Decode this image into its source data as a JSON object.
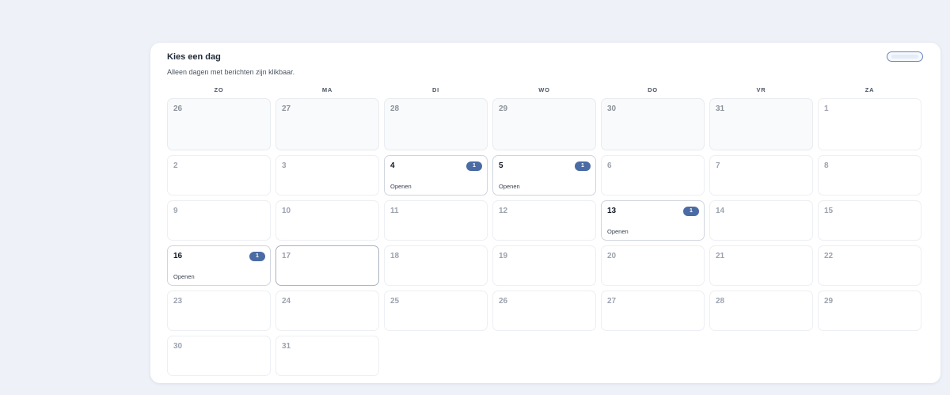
{
  "calendar": {
    "title": "Kies een dag",
    "subtitle": "Alleen dagen met berichten zijn klikbaar.",
    "weekdays": [
      "ZO",
      "MA",
      "DI",
      "WO",
      "DO",
      "VR",
      "ZA"
    ],
    "open_label": "Openen",
    "badge_color": "#4a6ba4",
    "days": [
      {
        "day": "26",
        "outside": true
      },
      {
        "day": "27",
        "outside": true
      },
      {
        "day": "28",
        "outside": true
      },
      {
        "day": "29",
        "outside": true
      },
      {
        "day": "30",
        "outside": true
      },
      {
        "day": "31",
        "outside": true
      },
      {
        "day": "1"
      },
      {
        "day": "2"
      },
      {
        "day": "3"
      },
      {
        "day": "4",
        "count": "1"
      },
      {
        "day": "5",
        "count": "1"
      },
      {
        "day": "6"
      },
      {
        "day": "7"
      },
      {
        "day": "8"
      },
      {
        "day": "9"
      },
      {
        "day": "10"
      },
      {
        "day": "11"
      },
      {
        "day": "12"
      },
      {
        "day": "13",
        "count": "1"
      },
      {
        "day": "14"
      },
      {
        "day": "15"
      },
      {
        "day": "16",
        "count": "1"
      },
      {
        "day": "17",
        "today": true
      },
      {
        "day": "18"
      },
      {
        "day": "19"
      },
      {
        "day": "20"
      },
      {
        "day": "21"
      },
      {
        "day": "22"
      },
      {
        "day": "23"
      },
      {
        "day": "24"
      },
      {
        "day": "25"
      },
      {
        "day": "26"
      },
      {
        "day": "27"
      },
      {
        "day": "28"
      },
      {
        "day": "29"
      },
      {
        "day": "30"
      },
      {
        "day": "31"
      }
    ]
  }
}
